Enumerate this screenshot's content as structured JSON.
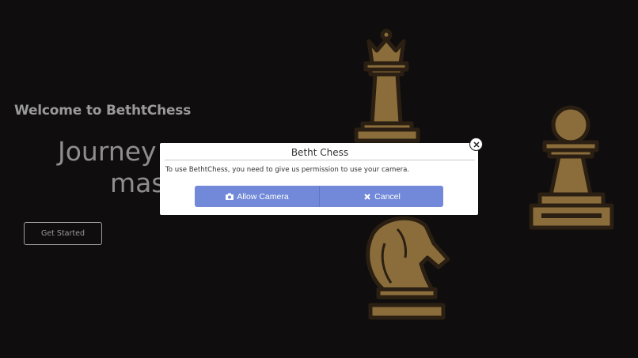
{
  "hero": {
    "welcome": "Welcome to BethtChess",
    "headline_line1": "Journey",
    "headline_line2": "mas",
    "cta_label": "Get Started"
  },
  "icons": {
    "pieces": [
      "queen-piece",
      "pawn-piece",
      "knight-piece"
    ],
    "camera": "camera-icon",
    "cancel": "x-icon",
    "close": "close-icon"
  },
  "colors": {
    "background": "#0f0d0d",
    "piece_fill": "#8a6d3b",
    "piece_outline": "#2a1f12",
    "button": "#7189d8"
  },
  "dialog": {
    "title": "Betht Chess",
    "message": "To use BethtChess, you need to give us permission to use your camera.",
    "allow_label": "Allow Camera",
    "cancel_label": "Cancel"
  }
}
